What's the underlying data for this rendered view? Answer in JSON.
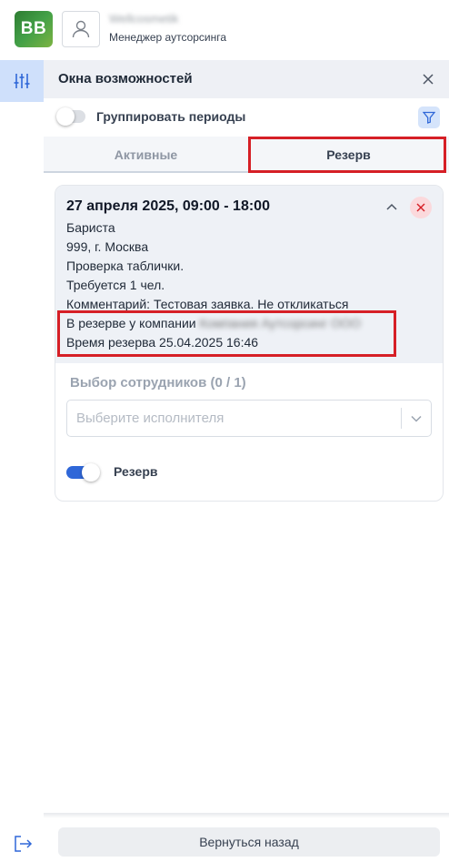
{
  "header": {
    "logo_text": "BB",
    "user_name": "Wellcosmetik",
    "user_role": "Менеджер аутсорсинга"
  },
  "panel": {
    "title": "Окна возможностей",
    "group_periods_label": "Группировать периоды",
    "group_periods_on": false
  },
  "tabs": [
    {
      "label": "Активные",
      "selected": false
    },
    {
      "label": "Резерв",
      "selected": true
    }
  ],
  "card": {
    "date": "27 апреля 2025, 09:00 - 18:00",
    "position": "Бариста",
    "address": "999, г. Москва",
    "note": "Проверка таблички.",
    "required": "Требуется 1 чел.",
    "comment": "Комментарий: Тестовая заявка. Не откликаться",
    "reserved_by_prefix": "В резерве у компании",
    "reserved_by_company": "Компания Аутсорсинг ООО",
    "reserve_time": "Время резерва 25.04.2025 16:46"
  },
  "staff_select": {
    "title": "Выбор сотрудников (0 / 1)",
    "placeholder": "Выберите исполнителя"
  },
  "reserve_toggle": {
    "label": "Резерв",
    "on": true
  },
  "footer": {
    "back_label": "Вернуться назад"
  },
  "colors": {
    "accent": "#2f67d8",
    "highlight": "#d61f26",
    "rail_active": "#cfe0fb",
    "danger_bg": "#fbd9dc"
  }
}
